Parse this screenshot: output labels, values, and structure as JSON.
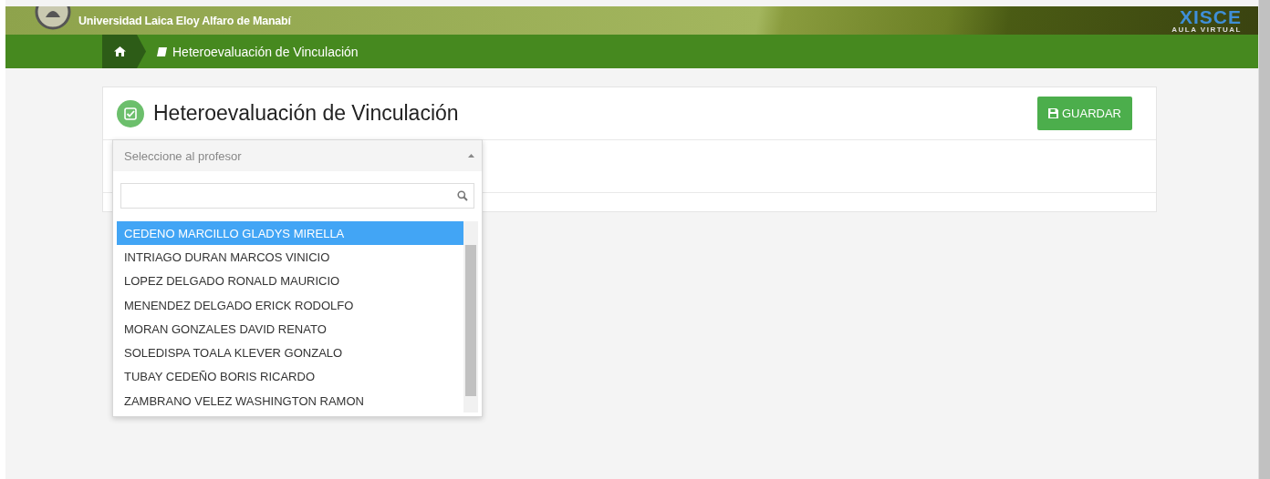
{
  "header": {
    "university": "Universidad Laica Eloy Alfaro de Manabí",
    "logo_text": "XISCE",
    "logo_subtitle": "AULA VIRTUAL"
  },
  "breadcrumb": {
    "current": "Heteroevaluación de Vinculación"
  },
  "card": {
    "title": "Heteroevaluación de Vinculación",
    "save_button": "GUARDAR"
  },
  "select": {
    "placeholder": "Seleccione al profesor",
    "expanded": true,
    "options": [
      {
        "label": "CEDENO MARCILLO GLADYS MIRELLA",
        "selected": true
      },
      {
        "label": "INTRIAGO DURAN MARCOS VINICIO",
        "selected": false
      },
      {
        "label": "LOPEZ DELGADO RONALD MAURICIO",
        "selected": false
      },
      {
        "label": "MENENDEZ DELGADO ERICK RODOLFO",
        "selected": false
      },
      {
        "label": "MORAN GONZALES DAVID RENATO",
        "selected": false
      },
      {
        "label": "SOLEDISPA TOALA KLEVER GONZALO",
        "selected": false
      },
      {
        "label": "TUBAY CEDEÑO BORIS RICARDO",
        "selected": false
      },
      {
        "label": "ZAMBRANO VELEZ WASHINGTON RAMON",
        "selected": false
      }
    ]
  }
}
